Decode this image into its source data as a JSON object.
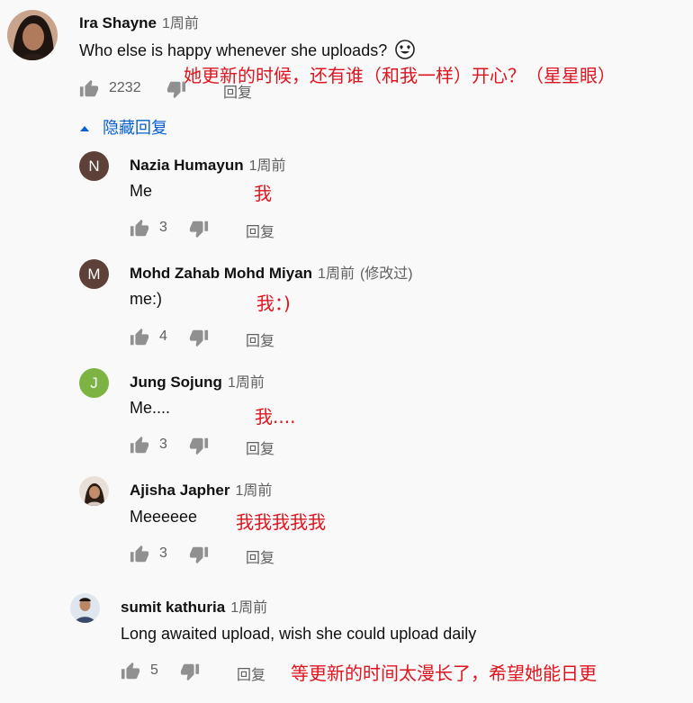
{
  "colors": {
    "accent": "#065fd4",
    "annotation": "#e0141e",
    "avatar_n": "#5d4037",
    "avatar_m": "#5d4037",
    "avatar_j": "#7cb342"
  },
  "icons": {
    "like": "thumbs-up-icon",
    "dislike": "thumbs-down-icon",
    "collapse": "caret-up-icon",
    "emoji": "heart-eyes-emoji"
  },
  "top_comment": {
    "author": "Ira Shayne",
    "time": "1周前",
    "text": "Who else is happy whenever she uploads?",
    "translation": "她更新的时候，还有谁（和我一样）开心？（星星眼）",
    "likes": "2232",
    "reply_label": "回复"
  },
  "hide_replies_label": "隐藏回复",
  "replies": [
    {
      "avatar_letter": "N",
      "author": "Nazia Humayun",
      "time": "1周前",
      "edited": "",
      "text": "Me",
      "translation": "我",
      "likes": "3",
      "reply_label": "回复"
    },
    {
      "avatar_letter": "M",
      "author": "Mohd Zahab Mohd Miyan",
      "time": "1周前",
      "edited": "(修改过)",
      "text": "me:)",
      "translation": "我：)",
      "likes": "4",
      "reply_label": "回复"
    },
    {
      "avatar_letter": "J",
      "author": "Jung Sojung",
      "time": "1周前",
      "edited": "",
      "text": "Me....",
      "translation": "我....",
      "likes": "3",
      "reply_label": "回复"
    },
    {
      "avatar_letter": "",
      "author": "Ajisha Japher",
      "time": "1周前",
      "edited": "",
      "text": "Meeeeee",
      "translation": "我我我我我",
      "likes": "3",
      "reply_label": "回复"
    }
  ],
  "bottom_comment": {
    "author": "sumit kathuria",
    "time": "1周前",
    "text": "Long awaited upload, wish she could upload daily",
    "translation": "等更新的时间太漫长了，希望她能日更",
    "likes": "5",
    "reply_label": "回复"
  }
}
